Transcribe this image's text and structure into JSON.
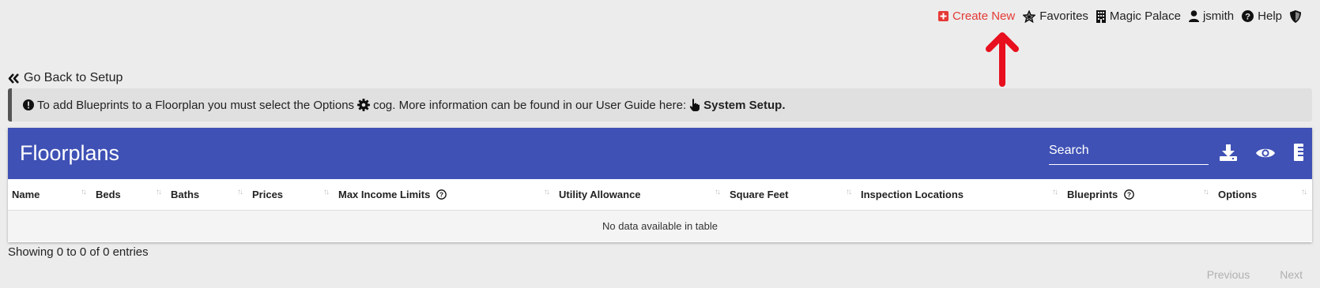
{
  "topnav": {
    "create_new": "Create New",
    "favorites": "Favorites",
    "property": "Magic Palace",
    "user": "jsmith",
    "help": "Help"
  },
  "back_link": "Go Back to Setup",
  "info": {
    "text_before": "To add Blueprints to a Floorplan you must select the Options",
    "text_after": "cog. More information can be found in our User Guide here:",
    "link": "System Setup."
  },
  "panel": {
    "title": "Floorplans",
    "search_placeholder": "Search",
    "columns": [
      "Name",
      "Beds",
      "Baths",
      "Prices",
      "Max Income Limits",
      "Utility Allowance",
      "Square Feet",
      "Inspection Locations",
      "Blueprints",
      "Options"
    ],
    "empty_message": "No data available in table"
  },
  "footer": {
    "showing": "Showing 0 to 0 of 0 entries",
    "previous": "Previous",
    "next": "Next"
  },
  "colors": {
    "header_bg": "#3f51b5",
    "create_new": "#e53935",
    "annotation_arrow": "#e8101e"
  }
}
